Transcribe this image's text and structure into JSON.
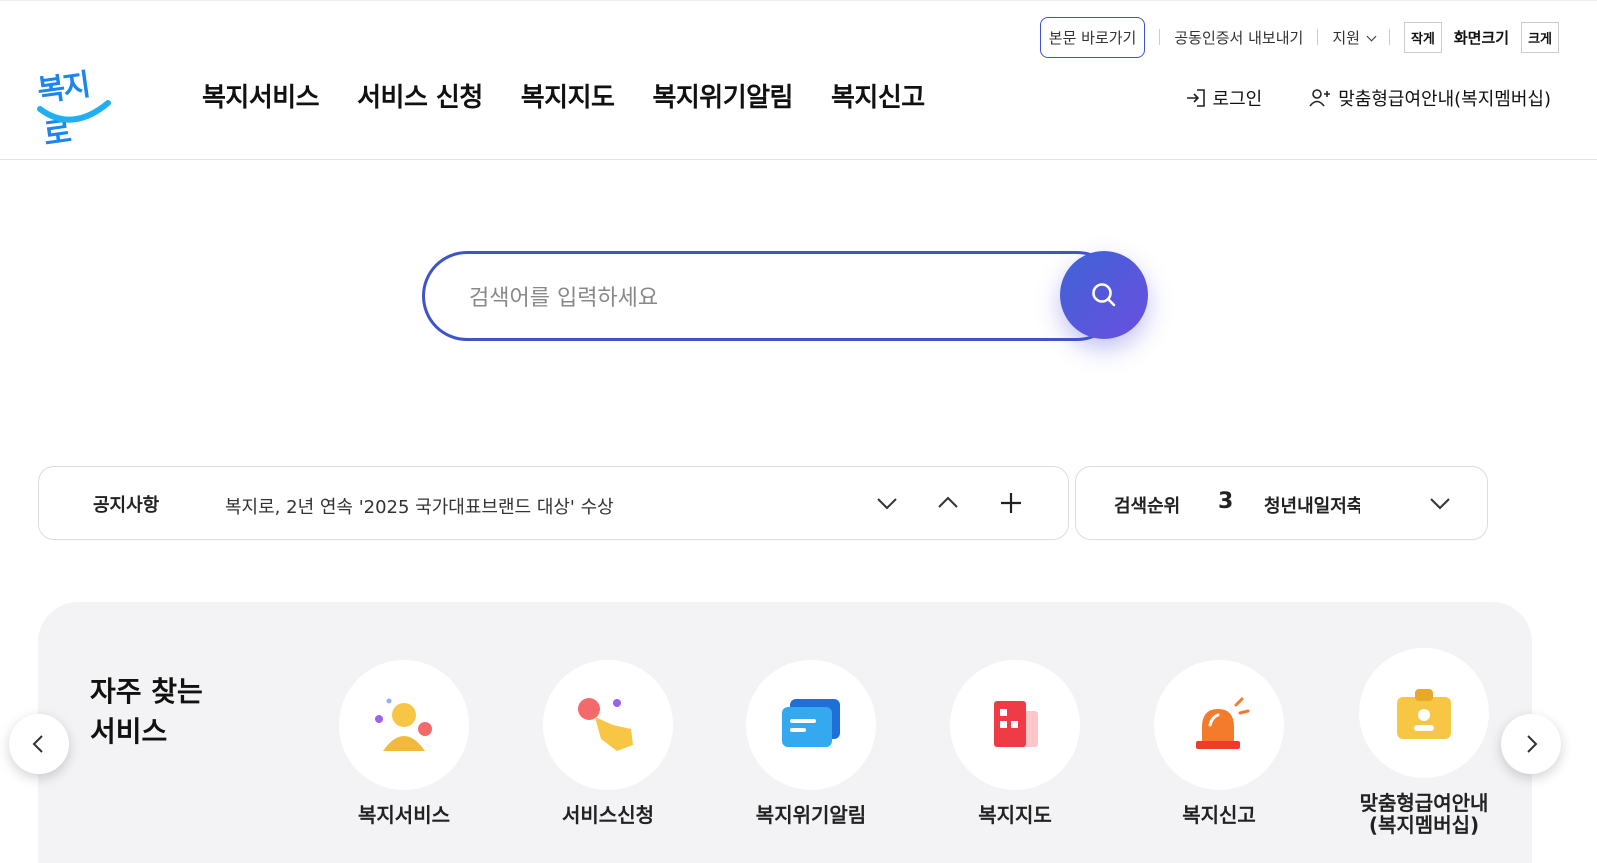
{
  "header": {
    "logo_text": "복지로",
    "skip_link": "본문 바로가기",
    "cert_export": "공동인증서 내보내기",
    "support": "지원",
    "size_small": "작게",
    "screen_size": "화면크기",
    "size_large": "크게",
    "nav": [
      "복지서비스",
      "서비스 신청",
      "복지지도",
      "복지위기알림",
      "복지신고"
    ],
    "login": "로그인",
    "membership": "맞춤형급여안내(복지멤버십)"
  },
  "search": {
    "placeholder": "검색어를 입력하세요"
  },
  "notice": {
    "label": "공지사항",
    "text": "복지로, 2년 연속 '2025 국가대표브랜드 대상' 수상"
  },
  "ranking": {
    "label": "검색순위",
    "number": "3",
    "term": "청년내일저축계좌"
  },
  "frequent": {
    "title": "자주 찾는 서비스",
    "items": [
      {
        "label": "복지서비스",
        "icon": "person-icon"
      },
      {
        "label": "서비스신청",
        "icon": "hand-tap-icon"
      },
      {
        "label": "복지위기알림",
        "icon": "message-icon"
      },
      {
        "label": "복지지도",
        "icon": "map-icon"
      },
      {
        "label": "복지신고",
        "icon": "siren-icon"
      },
      {
        "label": "맞춤형급여안내(복지멤버십)",
        "icon": "id-card-icon"
      }
    ]
  }
}
